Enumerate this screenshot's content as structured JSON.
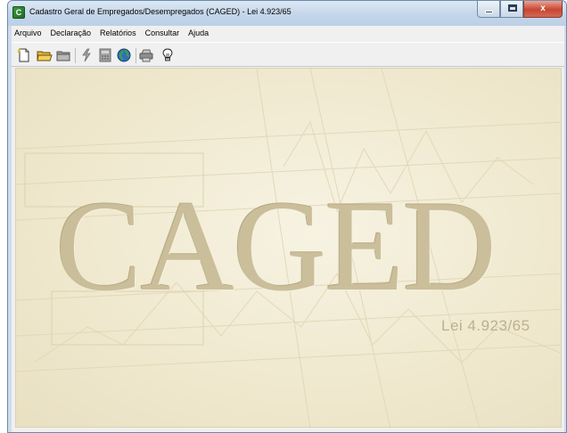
{
  "window": {
    "title": "Cadastro Geral de Empregados/Desempregados (CAGED) - Lei 4.923/65",
    "app_icon": "caged-app-icon",
    "controls": {
      "minimize": "minimize-icon",
      "maximize": "maximize-icon",
      "close": "close-icon",
      "close_glyph": "x"
    }
  },
  "menu": {
    "items": [
      {
        "label": "Arquivo"
      },
      {
        "label": "Declaração"
      },
      {
        "label": "Relatórios"
      },
      {
        "label": "Consultar"
      },
      {
        "label": "Ajuda"
      }
    ]
  },
  "toolbar": {
    "buttons": [
      {
        "icon": "new-document-icon"
      },
      {
        "icon": "open-folder-icon"
      },
      {
        "icon": "closed-folder-icon"
      },
      {
        "icon": "lightning-icon"
      },
      {
        "icon": "calculator-icon"
      },
      {
        "icon": "globe-icon"
      },
      {
        "icon": "printer-icon"
      },
      {
        "icon": "lightbulb-icon"
      }
    ]
  },
  "splash": {
    "logo_text": "CAGED",
    "law_text": "Lei 4.923/65",
    "colors": {
      "background": "#f0e9cf",
      "logo": "#c9bc98"
    }
  }
}
